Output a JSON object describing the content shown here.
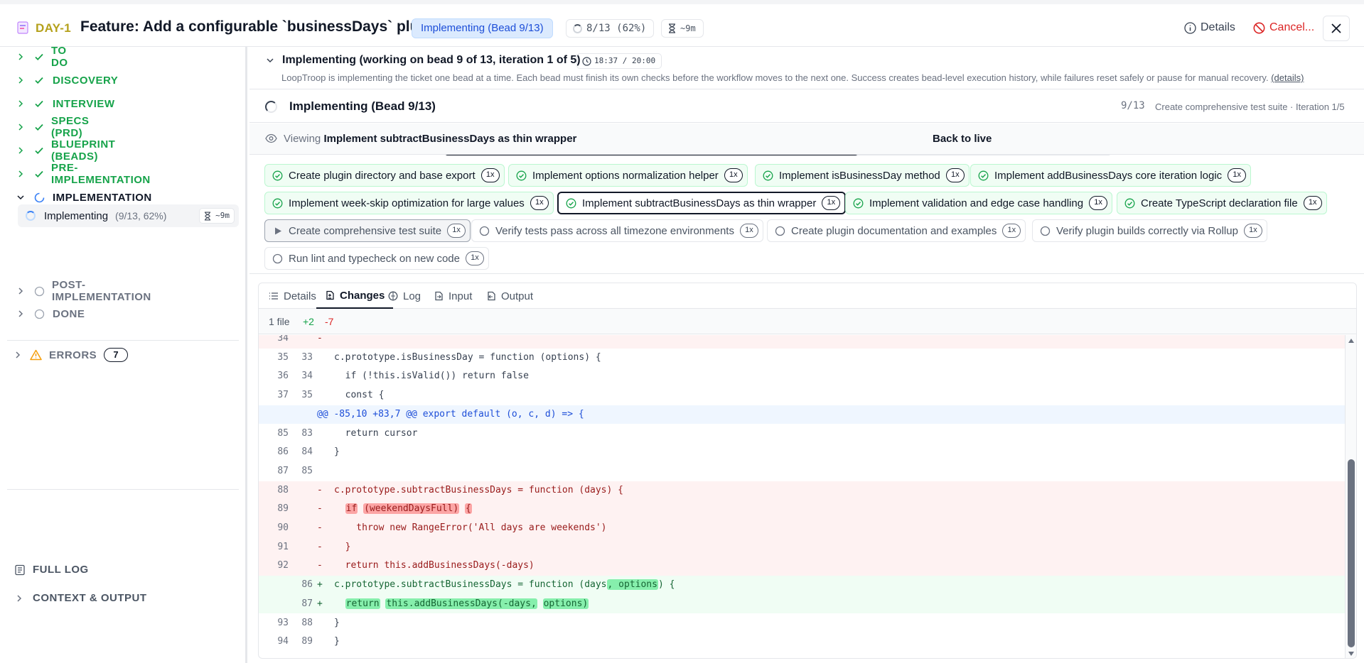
{
  "header": {
    "ticket_key": "DAY-1",
    "title": "Feature: Add a configurable `businessDays` plugin",
    "status": "Implementing (Bead 9/13)",
    "progress": "8/13 (62%)",
    "eta": "~9m",
    "details_label": "Details",
    "cancel_label": "Cancel..."
  },
  "sidebar": {
    "phases": [
      {
        "label": "TO DO",
        "state": "done"
      },
      {
        "label": "DISCOVERY",
        "state": "done"
      },
      {
        "label": "INTERVIEW",
        "state": "done"
      },
      {
        "label": "SPECS (PRD)",
        "state": "done"
      },
      {
        "label": "BLUEPRINT (BEADS)",
        "state": "done"
      },
      {
        "label": "PRE-IMPLEMENTATION",
        "state": "done"
      },
      {
        "label": "IMPLEMENTATION",
        "state": "active"
      },
      {
        "label": "POST-IMPLEMENTATION",
        "state": "pending"
      },
      {
        "label": "DONE",
        "state": "pending"
      }
    ],
    "sub_item": {
      "label": "Implementing",
      "count": "(9/13, 62%)",
      "eta": "~9m"
    },
    "errors": {
      "label": "ERRORS",
      "count": "7"
    },
    "full_log": "FULL LOG",
    "context_output": "CONTEXT & OUTPUT"
  },
  "stage": {
    "title": "Implementing (working on bead 9 of 13, iteration 1 of 5)",
    "clock": "18:37 / 20:00",
    "description": "LoopTroop is implementing the ticket one bead at a time. Each bead must finish its own checks before the workflow moves to the next one. Success creates bead-level execution history, while failures reset safely or pause for manual recovery.",
    "details_link": "(details)"
  },
  "progress": {
    "title": "Implementing (Bead 9/13)",
    "fraction": 0.62,
    "count": "9/13",
    "meta": "Create comprehensive test suite · Iteration 1/5"
  },
  "viewing": {
    "prefix": "Viewing",
    "bead": "Implement subtractBusinessDays as thin wrapper",
    "back": "Back to live"
  },
  "beads": [
    {
      "label": "Create plugin directory and base export",
      "count": "1x",
      "state": "done"
    },
    {
      "label": "Implement options normalization helper",
      "count": "1x",
      "state": "done"
    },
    {
      "label": "Implement isBusinessDay method",
      "count": "1x",
      "state": "done"
    },
    {
      "label": "Implement addBusinessDays core iteration logic",
      "count": "1x",
      "state": "done"
    },
    {
      "label": "Implement week-skip optimization for large values",
      "count": "1x",
      "state": "done"
    },
    {
      "label": "Implement subtractBusinessDays as thin wrapper",
      "count": "1x",
      "state": "viewed"
    },
    {
      "label": "Implement validation and edge case handling",
      "count": "1x",
      "state": "done"
    },
    {
      "label": "Create TypeScript declaration file",
      "count": "1x",
      "state": "done"
    },
    {
      "label": "Create comprehensive test suite",
      "count": "1x",
      "state": "current"
    },
    {
      "label": "Verify tests pass across all timezone environments",
      "count": "1x",
      "state": "pending"
    },
    {
      "label": "Create plugin documentation and examples",
      "count": "1x",
      "state": "pending"
    },
    {
      "label": "Verify plugin builds correctly via Rollup",
      "count": "1x",
      "state": "pending"
    },
    {
      "label": "Run lint and typecheck on new code",
      "count": "1x",
      "state": "pending"
    }
  ],
  "tabs": [
    "Details",
    "Changes",
    "Log",
    "Input",
    "Output"
  ],
  "active_tab": "Changes",
  "diff": {
    "file_count": "1 file",
    "additions": "+2",
    "deletions": "-7",
    "lines": [
      {
        "type": "del",
        "old": "34",
        "new": "",
        "sign": "-",
        "code": ""
      },
      {
        "type": "ctx",
        "old": "35",
        "new": "33",
        "sign": "",
        "code": "c.prototype.isBusinessDay = function (options) {"
      },
      {
        "type": "ctx",
        "old": "36",
        "new": "34",
        "sign": "",
        "code": "  if (!this.isValid()) return false"
      },
      {
        "type": "ctx",
        "old": "37",
        "new": "35",
        "sign": "",
        "code": "  const {"
      },
      {
        "type": "hunk",
        "old": "",
        "new": "",
        "sign": "",
        "code": "@@ -85,10 +83,7 @@ export default (o, c, d) => {"
      },
      {
        "type": "ctx",
        "old": "85",
        "new": "83",
        "sign": "",
        "code": "  return cursor"
      },
      {
        "type": "ctx",
        "old": "86",
        "new": "84",
        "sign": "",
        "code": "}"
      },
      {
        "type": "ctx",
        "old": "87",
        "new": "85",
        "sign": "",
        "code": ""
      },
      {
        "type": "del",
        "old": "88",
        "new": "",
        "sign": "-",
        "code": "c.prototype.subtractBusinessDays = function (days) {"
      },
      {
        "type": "del",
        "old": "89",
        "new": "",
        "sign": "-",
        "code": "  if (weekendDaysFull) {"
      },
      {
        "type": "del",
        "old": "90",
        "new": "",
        "sign": "-",
        "code": "    throw new RangeError('All days are weekends')"
      },
      {
        "type": "del",
        "old": "91",
        "new": "",
        "sign": "-",
        "code": "  }"
      },
      {
        "type": "del",
        "old": "92",
        "new": "",
        "sign": "-",
        "code": "  return this.addBusinessDays(-days)"
      },
      {
        "type": "add",
        "old": "",
        "new": "86",
        "sign": "+",
        "code": "c.prototype.subtractBusinessDays = function (days, options) {"
      },
      {
        "type": "add",
        "old": "",
        "new": "87",
        "sign": "+",
        "code": "  return this.addBusinessDays(-days, options)"
      },
      {
        "type": "ctx",
        "old": "93",
        "new": "88",
        "sign": "",
        "code": "}"
      },
      {
        "type": "ctx",
        "old": "94",
        "new": "89",
        "sign": "",
        "code": "}"
      }
    ]
  },
  "colors": {
    "done": "#16a34a",
    "active_blue": "#3b82f6",
    "cancel": "#dc2626",
    "ticket_key": "#b5a11c"
  }
}
